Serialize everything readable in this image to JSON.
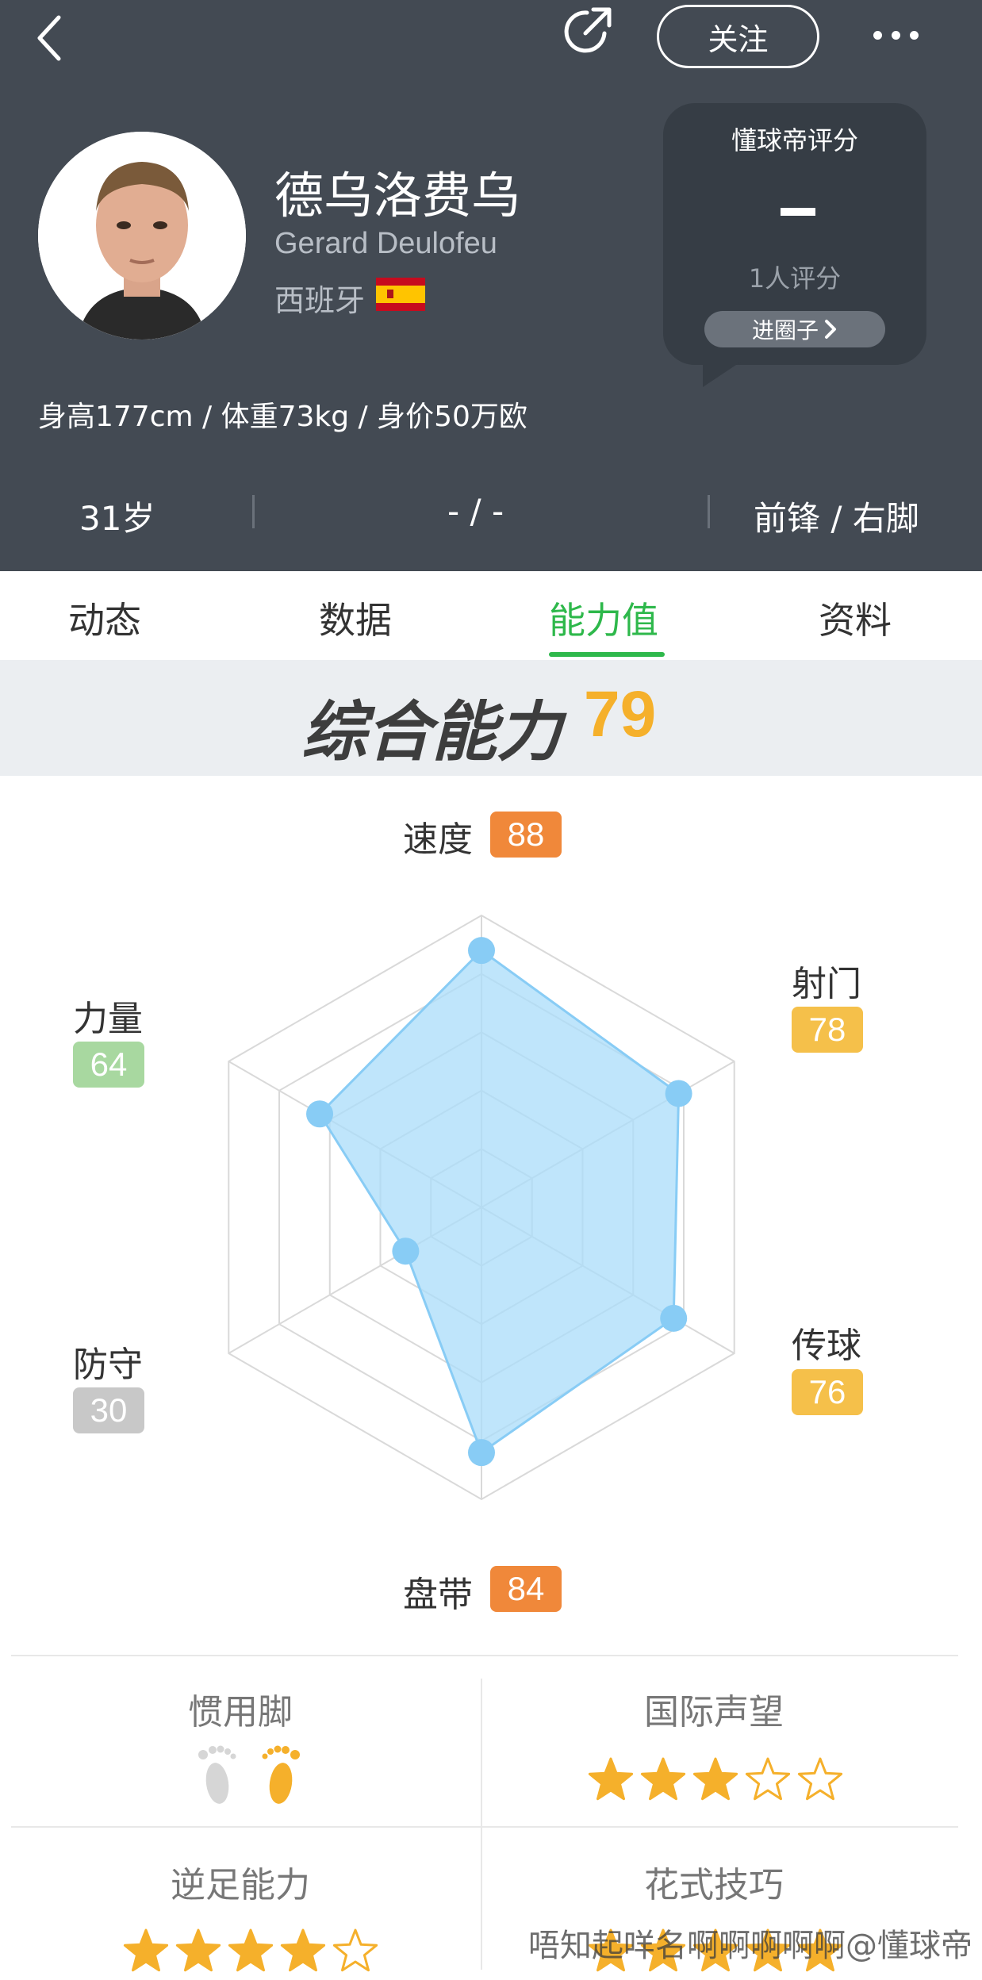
{
  "header": {
    "follow_label": "关注",
    "player_name_cn": "德乌洛费乌",
    "player_name_en": "Gerard Deulofeu",
    "country": "西班牙",
    "rating": {
      "title": "懂球帝评分",
      "value": "-",
      "count": "1人评分",
      "circle_button": "进圈子"
    },
    "body_info": "身高177cm / 体重73kg / 身价50万欧",
    "stats": {
      "age": "31岁",
      "number": "- / -",
      "position": "前锋 / 右脚"
    }
  },
  "tabs": [
    {
      "label": "动态",
      "active": false
    },
    {
      "label": "数据",
      "active": false
    },
    {
      "label": "能力值",
      "active": true
    },
    {
      "label": "资料",
      "active": false
    }
  ],
  "overall": {
    "label": "综合能力",
    "value": "79"
  },
  "radar": {
    "attributes": [
      {
        "label": "速度",
        "value": 88,
        "color": "#f0883a"
      },
      {
        "label": "射门",
        "value": 78,
        "color": "#f5c04a"
      },
      {
        "label": "传球",
        "value": 76,
        "color": "#f5c04a"
      },
      {
        "label": "盘带",
        "value": 84,
        "color": "#f0883a"
      },
      {
        "label": "防守",
        "value": 30,
        "color": "#c8c8c8"
      },
      {
        "label": "力量",
        "value": 64,
        "color": "#a8d8a0"
      }
    ],
    "fill_color": "#a9dcf9",
    "point_color": "#88ccf5",
    "max": 100
  },
  "traits": {
    "preferred_foot": {
      "title": "惯用脚",
      "left_active": false,
      "right_active": true
    },
    "reputation": {
      "title": "国际声望",
      "stars": 3,
      "max": 5
    },
    "weak_foot": {
      "title": "逆足能力",
      "stars": 4,
      "max": 5
    },
    "skill_moves": {
      "title": "花式技巧",
      "stars": 5,
      "max": 5
    }
  },
  "watermark": "唔知起咩名啊啊啊啊啊@懂球帝",
  "icons": [
    "back-arrow-icon",
    "share-icon",
    "more-icon",
    "spain-flag-icon",
    "chevron-right-icon",
    "footprint-icon",
    "star-icon"
  ]
}
